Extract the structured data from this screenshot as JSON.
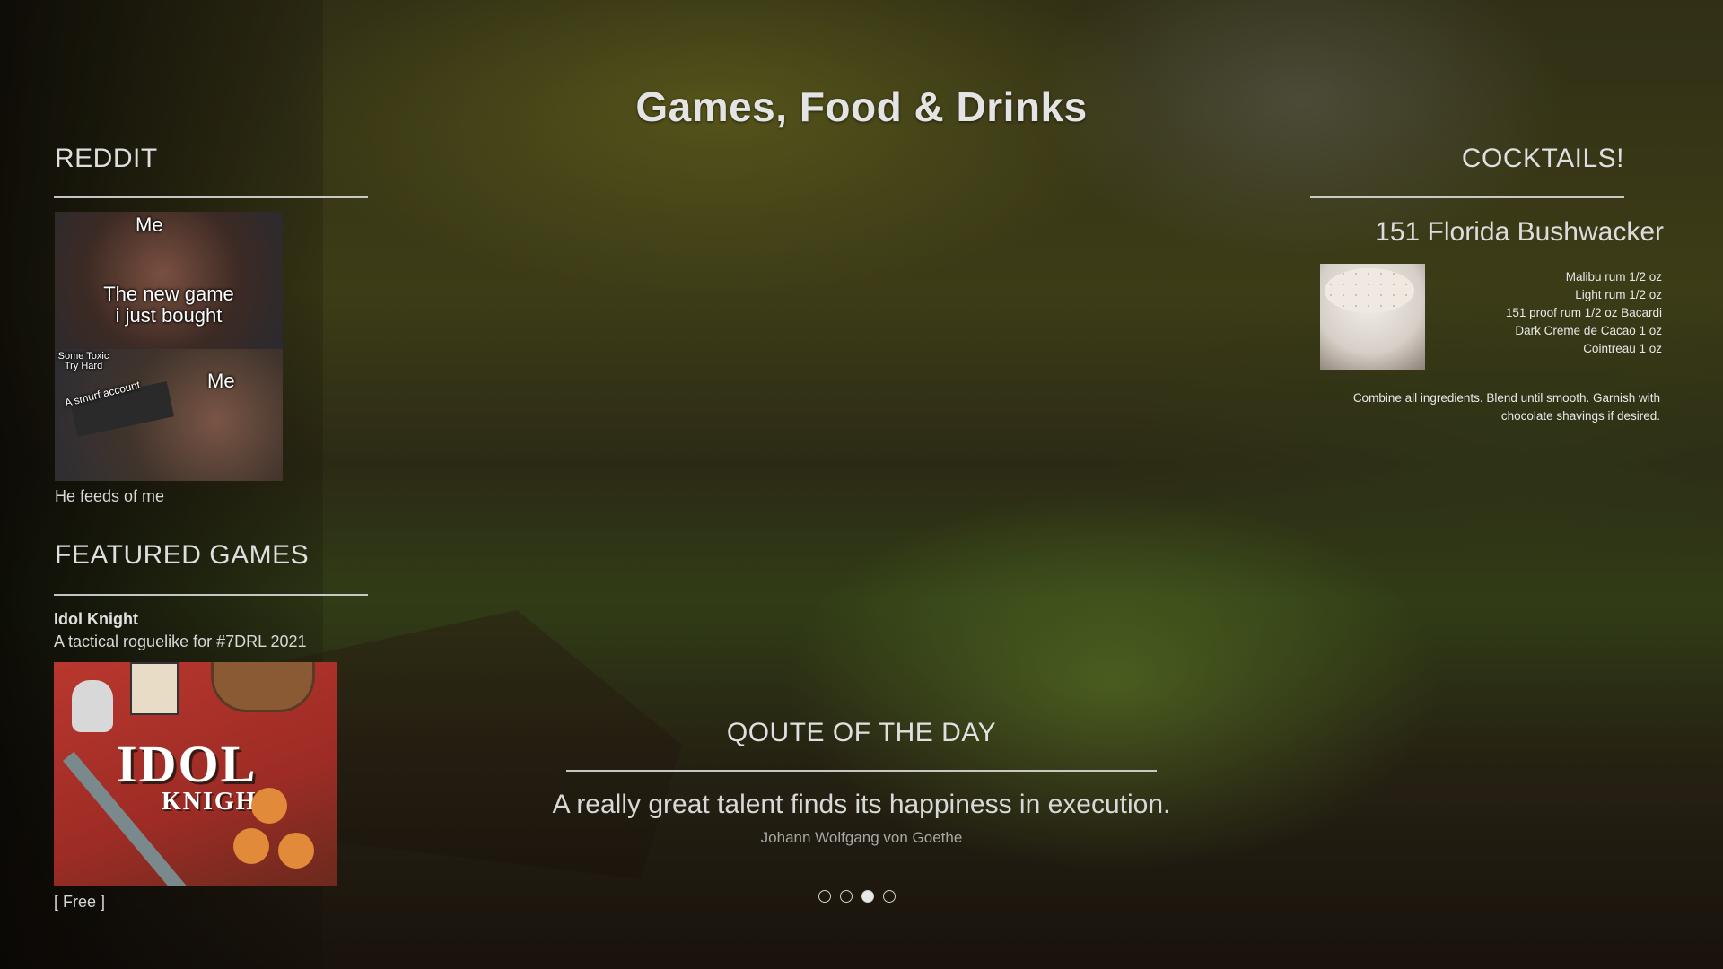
{
  "page": {
    "title": "Games, Food & Drinks"
  },
  "reddit": {
    "heading": "REDDIT",
    "meme_captions": {
      "top_label": "Me",
      "top_text_line1": "The new game",
      "top_text_line2": "i just bought",
      "bottom_left_line1": "Some Toxic",
      "bottom_left_line2": "Try Hard",
      "bottom_gun_label": "A smurf account",
      "bottom_right_label": "Me"
    },
    "post_caption": "He feeds of me"
  },
  "featured_games": {
    "heading": "FEATURED GAMES",
    "game": {
      "title": "Idol Knight",
      "description": "A tactical roguelike for #7DRL 2021",
      "logo_line1": "IDOL",
      "logo_line2": "KNIGHT",
      "price": "[ Free ]"
    }
  },
  "cocktails": {
    "heading": "COCKTAILS!",
    "drink": {
      "name": "151 Florida Bushwacker",
      "ingredients": [
        "Malibu rum 1/2 oz",
        "Light rum 1/2 oz",
        "151 proof rum 1/2 oz Bacardi",
        "Dark Creme de Cacao 1 oz",
        "Cointreau 1 oz"
      ],
      "instructions": "Combine all ingredients. Blend until smooth. Garnish with chocolate shavings if desired."
    }
  },
  "quote": {
    "heading": "QOUTE OF THE DAY",
    "text": "A really great talent finds its happiness in execution.",
    "author": "Johann Wolfgang von Goethe"
  },
  "carousel": {
    "count": 4,
    "active_index": 2
  }
}
